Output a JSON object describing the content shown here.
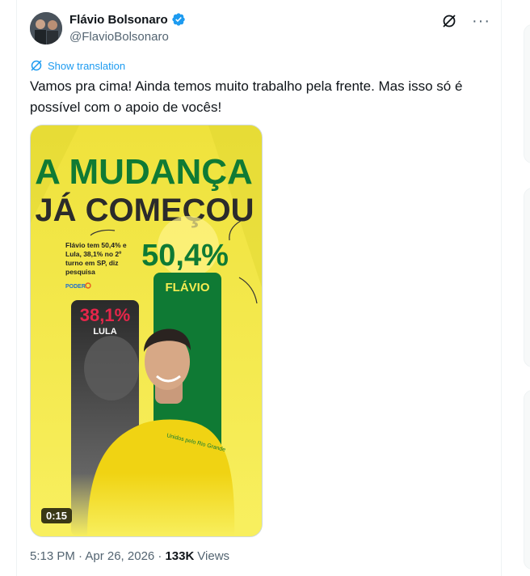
{
  "author": {
    "name": "Flávio Bolsonaro",
    "handle": "@FlavioBolsonaro",
    "verified": true
  },
  "translate_label": "Show translation",
  "text": "Vamos pra cima! Ainda temos muito trabalho pela frente. Mas isso só é possível com o apoio de vocês!",
  "media": {
    "headline1": "A MUDANÇA",
    "headline2": "JÁ COMEÇOU",
    "caption": [
      "Flávio tem 50,4% e",
      "Lula, 38,1% no 2º",
      "turno em SP, diz",
      "pesquisa"
    ],
    "source_logo": "PODER",
    "flavio_pct": "50,4%",
    "flavio_label": "FLÁVIO",
    "lula_pct": "38,1%",
    "lula_label": "LULA",
    "shirt_text": "Unidos pelo Rio Grande",
    "duration": "0:15"
  },
  "meta": {
    "time": "5:13 PM · Apr 26, 2026 ·",
    "views_count": "133K",
    "views_label": "Views"
  },
  "colors": {
    "verified": "#1d9bf0",
    "link": "#1d9bf0",
    "yellow": "#f5ec52",
    "green": "#0f7a34",
    "red": "#e6264a"
  }
}
